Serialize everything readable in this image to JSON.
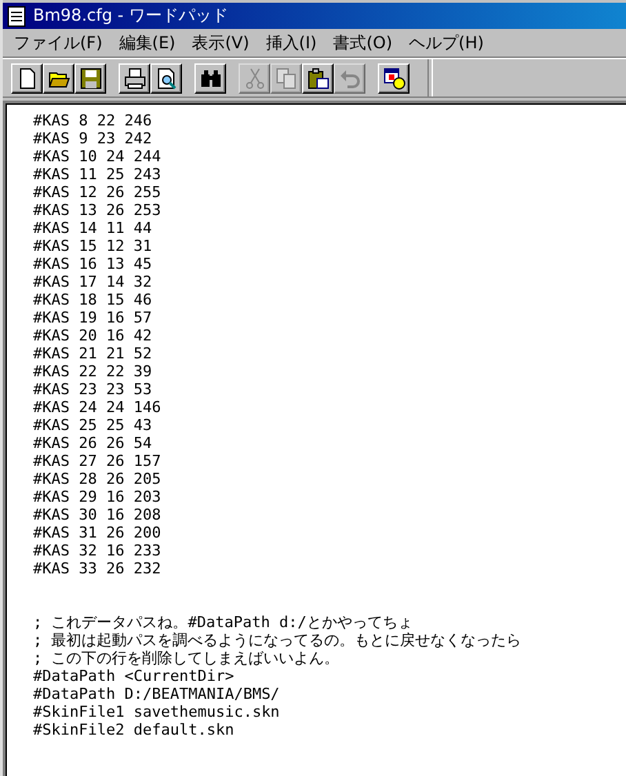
{
  "window": {
    "title": "Bm98.cfg - ワードパッド"
  },
  "menu": [
    "ファイル(F)",
    "編集(E)",
    "表示(V)",
    "挿入(I)",
    "書式(O)",
    "ヘルプ(H)"
  ],
  "toolbar": [
    [
      {
        "kind": "new",
        "disabled": false
      },
      {
        "kind": "open",
        "disabled": false
      },
      {
        "kind": "save",
        "disabled": false
      }
    ],
    [
      {
        "kind": "print",
        "disabled": false
      },
      {
        "kind": "preview",
        "disabled": false
      }
    ],
    [
      {
        "kind": "find",
        "disabled": false
      }
    ],
    [
      {
        "kind": "cut",
        "disabled": true
      },
      {
        "kind": "copy",
        "disabled": true
      },
      {
        "kind": "paste",
        "disabled": false
      },
      {
        "kind": "undo",
        "disabled": true
      }
    ],
    [
      {
        "kind": "datetime",
        "disabled": false
      }
    ]
  ],
  "document": {
    "blocks": [
      {
        "lines": [
          "#KAS 8 22 246",
          "#KAS 9 23 242",
          "#KAS 10 24 244",
          "#KAS 11 25 243",
          "#KAS 12 26 255",
          "#KAS 13 26 253",
          "#KAS 14 11 44",
          "#KAS 15 12 31",
          "#KAS 16 13 45",
          "#KAS 17 14 32",
          "#KAS 18 15 46",
          "#KAS 19 16 57",
          "#KAS 20 16 42",
          "#KAS 21 21 52",
          "#KAS 22 22 39",
          "#KAS 23 23 53",
          "#KAS 24 24 146",
          "#KAS 25 25 43",
          "#KAS 26 26 54",
          "#KAS 27 26 157",
          "#KAS 28 26 205",
          "#KAS 29 16 203",
          "#KAS 30 16 208",
          "#KAS 31 26 200",
          "#KAS 32 16 233",
          "#KAS 33 26 232"
        ]
      },
      {
        "lines": [
          "; これデータパスね。#DataPath d:/とかやってちょ",
          "; 最初は起動パスを調べるようになってるの。もとに戻せなくなったら",
          "; この下の行を削除してしまえばいいよん。",
          "#DataPath <CurrentDir>",
          "#DataPath D:/BEATMANIA/BMS/",
          "#SkinFile1 savethemusic.skn",
          "#SkinFile2 default.skn"
        ]
      }
    ]
  }
}
